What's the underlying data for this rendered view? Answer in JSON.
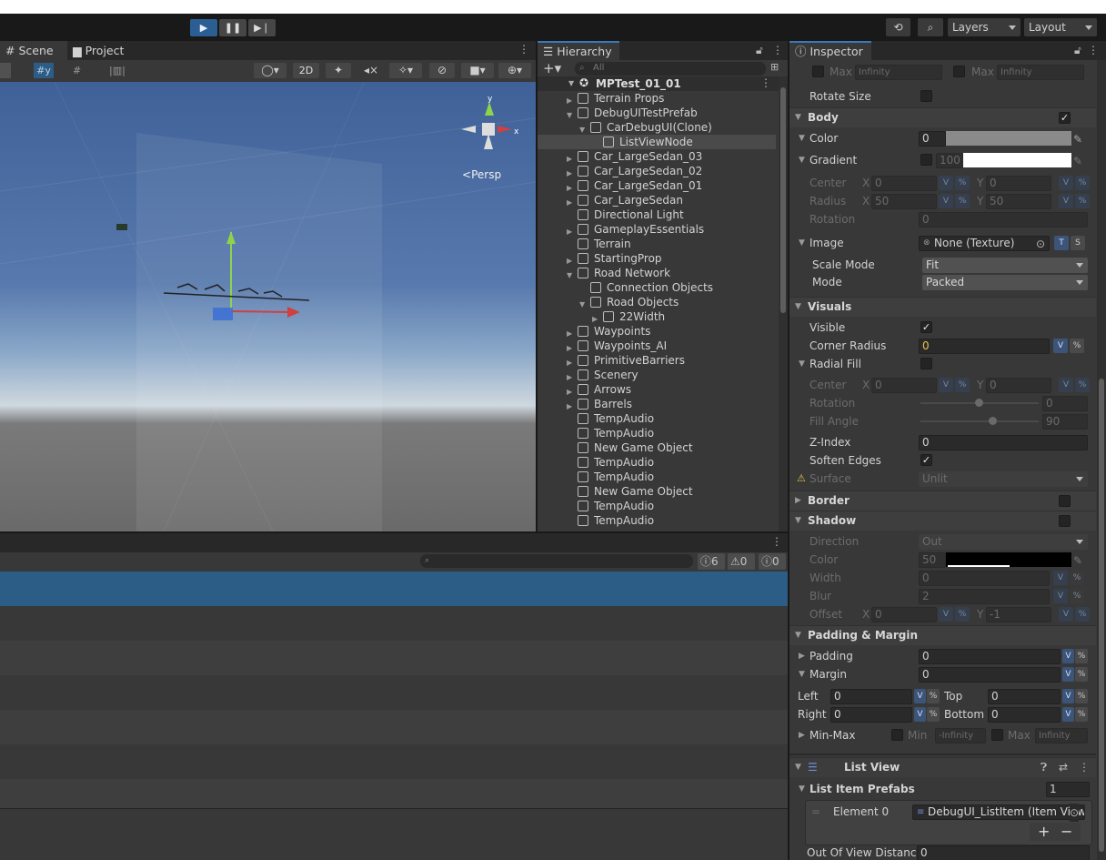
{
  "toolbar": {
    "play_icon": "play-icon",
    "pause_icon": "pause-icon",
    "step_icon": "step-icon",
    "layers_label": "Layers",
    "layout_label": "Layout"
  },
  "scene_panel": {
    "tabs": [
      {
        "label": "Scene"
      },
      {
        "label": "Project"
      }
    ],
    "toggle_2d": "2D",
    "persp_label": "Persp"
  },
  "hierarchy": {
    "tab_label": "Hierarchy",
    "search_placeholder": "All",
    "scene_name": "MPTest_01_01",
    "items": [
      {
        "label": "Terrain Props",
        "indent": 1,
        "arrow": "right"
      },
      {
        "label": "DebugUITestPrefab",
        "indent": 1,
        "arrow": "down"
      },
      {
        "label": "CarDebugUI(Clone)",
        "indent": 2,
        "arrow": "down"
      },
      {
        "label": "ListViewNode",
        "indent": 3,
        "arrow": "none",
        "selected": true
      },
      {
        "label": "Car_LargeSedan_03",
        "indent": 1,
        "arrow": "right"
      },
      {
        "label": "Car_LargeSedan_02",
        "indent": 1,
        "arrow": "right"
      },
      {
        "label": "Car_LargeSedan_01",
        "indent": 1,
        "arrow": "right"
      },
      {
        "label": "Car_LargeSedan",
        "indent": 1,
        "arrow": "right"
      },
      {
        "label": "Directional Light",
        "indent": 1,
        "arrow": "none"
      },
      {
        "label": "GameplayEssentials",
        "indent": 1,
        "arrow": "right"
      },
      {
        "label": "Terrain",
        "indent": 1,
        "arrow": "none"
      },
      {
        "label": "StartingProp",
        "indent": 1,
        "arrow": "right"
      },
      {
        "label": "Road Network",
        "indent": 1,
        "arrow": "down"
      },
      {
        "label": "Connection Objects",
        "indent": 2,
        "arrow": "none"
      },
      {
        "label": "Road Objects",
        "indent": 2,
        "arrow": "down"
      },
      {
        "label": "22Width",
        "indent": 3,
        "arrow": "right"
      },
      {
        "label": "Waypoints",
        "indent": 1,
        "arrow": "right"
      },
      {
        "label": "Waypoints_AI",
        "indent": 1,
        "arrow": "right"
      },
      {
        "label": "PrimitiveBarriers",
        "indent": 1,
        "arrow": "right"
      },
      {
        "label": "Scenery",
        "indent": 1,
        "arrow": "right"
      },
      {
        "label": "Arrows",
        "indent": 1,
        "arrow": "right"
      },
      {
        "label": "Barrels",
        "indent": 1,
        "arrow": "right"
      },
      {
        "label": "TempAudio",
        "indent": 1,
        "arrow": "none"
      },
      {
        "label": "TempAudio",
        "indent": 1,
        "arrow": "none"
      },
      {
        "label": "New Game Object",
        "indent": 1,
        "arrow": "none"
      },
      {
        "label": "TempAudio",
        "indent": 1,
        "arrow": "none"
      },
      {
        "label": "TempAudio",
        "indent": 1,
        "arrow": "none"
      },
      {
        "label": "New Game Object",
        "indent": 1,
        "arrow": "none"
      },
      {
        "label": "TempAudio",
        "indent": 1,
        "arrow": "none"
      },
      {
        "label": "TempAudio",
        "indent": 1,
        "arrow": "none"
      }
    ]
  },
  "console": {
    "info_count": "6",
    "warn_count": "0",
    "error_count": "0"
  },
  "inspector": {
    "tab_label": "Inspector",
    "top": {
      "max1": "Max",
      "infinity1": "Infinity",
      "max2": "Max",
      "infinity2": "Infinity"
    },
    "rotate_size": "Rotate Size",
    "body": {
      "title": "Body",
      "color_label": "Color",
      "color_value": "0",
      "gradient_label": "Gradient",
      "gradient_value": "100",
      "center_label": "Center",
      "center_x": "0",
      "center_y": "0",
      "radius_label": "Radius",
      "radius_x": "50",
      "radius_y": "50",
      "rotation_label": "Rotation",
      "rotation_value": "0",
      "image_label": "Image",
      "image_value": "None (Texture)",
      "scale_mode_label": "Scale Mode",
      "scale_mode_value": "Fit",
      "mode_label": "Mode",
      "mode_value": "Packed"
    },
    "visuals": {
      "title": "Visuals",
      "visible_label": "Visible",
      "corner_radius_label": "Corner Radius",
      "corner_radius_value": "0",
      "radial_fill_label": "Radial Fill",
      "center_label": "Center",
      "center_x": "0",
      "center_y": "0",
      "rotation_label": "Rotation",
      "rotation_value": "0",
      "fill_angle_label": "Fill Angle",
      "fill_angle_value": "90",
      "z_index_label": "Z-Index",
      "z_index_value": "0",
      "soften_edges_label": "Soften Edges",
      "surface_label": "Surface",
      "surface_value": "Unlit"
    },
    "border": {
      "title": "Border"
    },
    "shadow": {
      "title": "Shadow",
      "direction_label": "Direction",
      "direction_value": "Out",
      "color_label": "Color",
      "color_value": "50",
      "width_label": "Width",
      "width_value": "0",
      "blur_label": "Blur",
      "blur_value": "2",
      "offset_label": "Offset",
      "offset_x": "0",
      "offset_y": "-1"
    },
    "padding_margin": {
      "title": "Padding & Margin",
      "padding_label": "Padding",
      "padding_value": "0",
      "margin_label": "Margin",
      "margin_value": "0",
      "left_label": "Left",
      "left_value": "0",
      "top_label": "Top",
      "top_value": "0",
      "right_label": "Right",
      "right_value": "0",
      "bottom_label": "Bottom",
      "bottom_value": "0",
      "minmax_label": "Min-Max",
      "min_label": "Min",
      "min_value": "-Infinity",
      "max_label": "Max",
      "max_value": "Infinity"
    },
    "list_view": {
      "title": "List View",
      "prefabs_label": "List Item Prefabs",
      "prefabs_count": "1",
      "element_label": "Element 0",
      "element_value": "DebugUI_ListItem (Item View)",
      "out_of_view_label": "Out Of View Distance",
      "out_of_view_value": "0"
    },
    "labels": {
      "x": "X",
      "y": "Y",
      "v": "V",
      "pct": "%",
      "t": "T",
      "s": "S"
    }
  },
  "colors": {
    "accent": "#3a79bb",
    "selection": "#2c5d87",
    "play_active": "#2b5f93"
  }
}
